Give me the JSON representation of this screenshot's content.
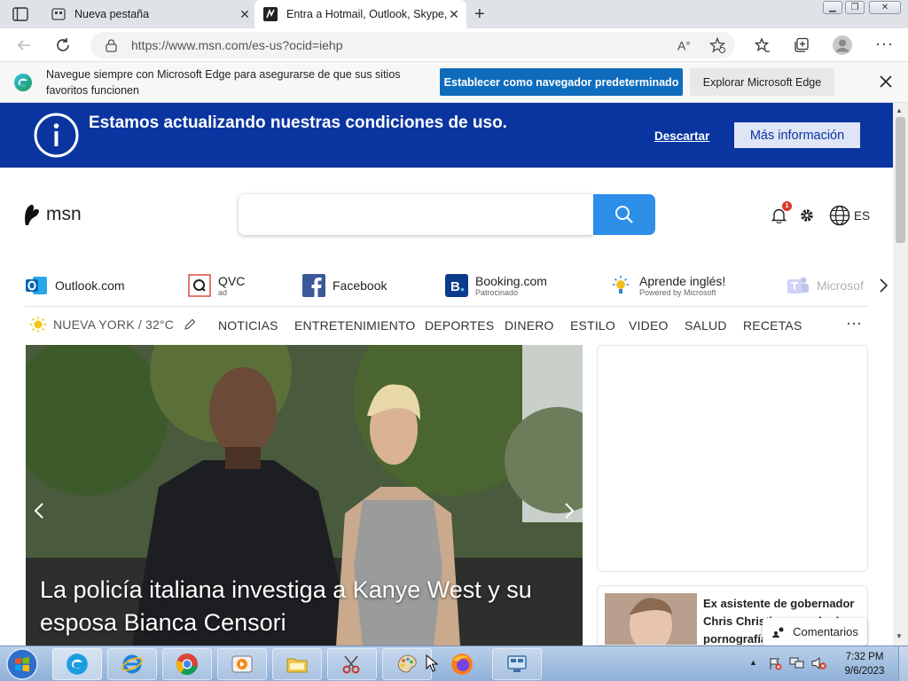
{
  "browser": {
    "tabs": [
      {
        "title": "Nueva pestaña",
        "active": false
      },
      {
        "title": "Entra a Hotmail, Outlook, Skype, Bing",
        "active": true
      }
    ],
    "url": "https://www.msn.com/es-us?ocid=iehp"
  },
  "infobar": {
    "message": "Navegue siempre con Microsoft Edge para asegurarse de que sus sitios favoritos funcionen",
    "primary_button": "Establecer como navegador predeterminado",
    "secondary_button": "Explorar Microsoft Edge"
  },
  "banner": {
    "text": "Estamos actualizando nuestras condiciones de uso.",
    "dismiss": "Descartar",
    "more_info": "Más información"
  },
  "msn": {
    "logo": "msn",
    "notification_count": "1",
    "language": "ES"
  },
  "quicklinks": [
    {
      "label": "Outlook.com",
      "sub": ""
    },
    {
      "label": "QVC",
      "sub": "ad"
    },
    {
      "label": "Facebook",
      "sub": ""
    },
    {
      "label": "Booking.com",
      "sub": "Patrocinado"
    },
    {
      "label": "Aprende inglés!",
      "sub": "Powered by Microsoft"
    },
    {
      "label": "Microsof",
      "sub": ""
    }
  ],
  "weather": {
    "location": "NUEVA YORK / 32°C"
  },
  "nav": [
    "NOTICIAS",
    "ENTRETENIMIENTO",
    "DEPORTES",
    "DINERO",
    "ESTILO",
    "VIDEO",
    "SALUD",
    "RECETAS"
  ],
  "hero": {
    "title": "La policía italiana investiga a Kanye West y su esposa Bianca Censori"
  },
  "side_card": {
    "title": "Ex asistente de gobernador Chris Christie acusado de pornografía"
  },
  "comments_button": "Comentarios",
  "taskbar": {
    "time": "7:32 PM",
    "date": "9/6/2023"
  },
  "colors": {
    "banner": "#0a35a0",
    "accent": "#0f6cbd",
    "search_button": "#2d8ee8"
  }
}
